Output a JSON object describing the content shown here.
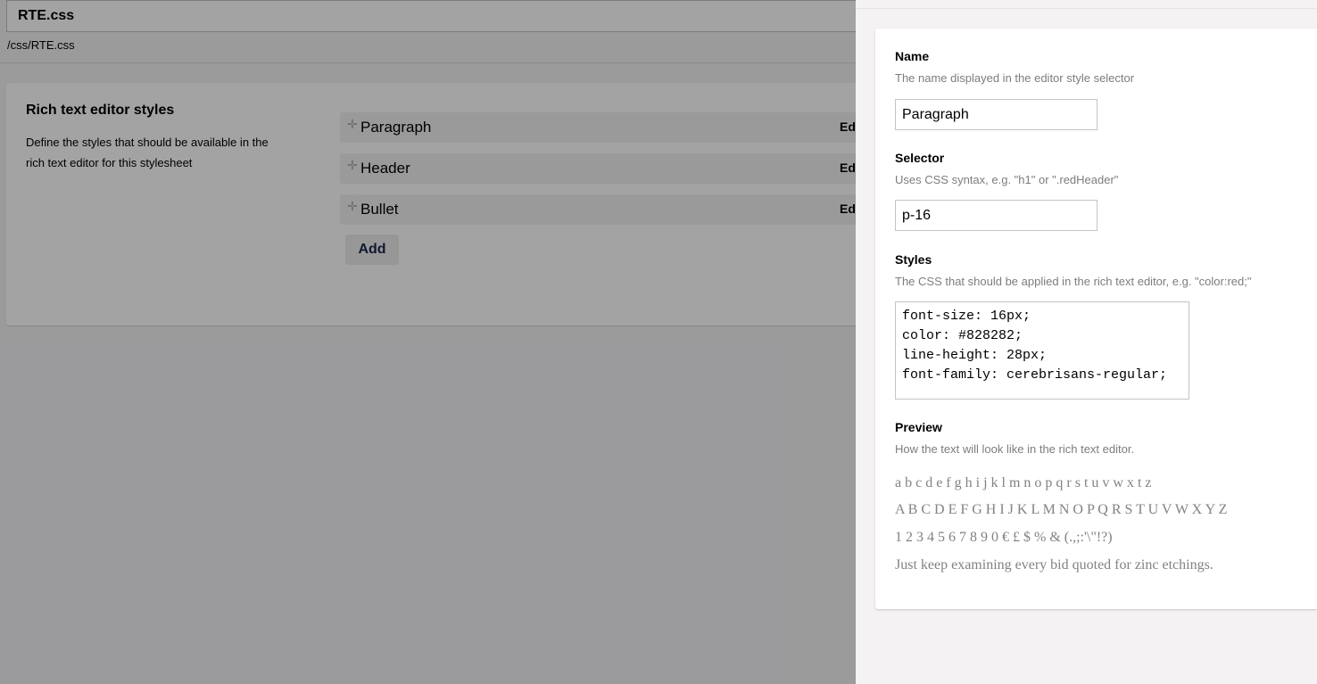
{
  "editor": {
    "name_value": "RTE.css",
    "path": "/css/RTE.css"
  },
  "rte_panel": {
    "title": "Rich text editor styles",
    "description": "Define the styles that should be available in the rich text editor for this stylesheet",
    "rules": [
      {
        "label": "Paragraph",
        "edit_label": "Ed"
      },
      {
        "label": "Header",
        "edit_label": "Ed"
      },
      {
        "label": "Bullet",
        "edit_label": "Ed"
      }
    ],
    "drag_icon": "move-handle-icon",
    "add_label": "Add"
  },
  "dialog": {
    "name": {
      "label": "Name",
      "description": "The name displayed in the editor style selector",
      "value": "Paragraph"
    },
    "selector": {
      "label": "Selector",
      "description": "Uses CSS syntax, e.g. \"h1\" or \".redHeader\"",
      "value": "p-16"
    },
    "styles": {
      "label": "Styles",
      "description": "The CSS that should be applied in the rich text editor, e.g. \"color:red;\"",
      "value": "font-size: 16px;\ncolor: #828282;\nline-height: 28px;\nfont-family: cerebrisans-regular;"
    },
    "preview": {
      "label": "Preview",
      "description": "How the text will look like in the rich text editor.",
      "lines": [
        "a b c d e f g h i j k l m n o p q r s t u v w x t z",
        "A B C D E F G H I J K L M N O P Q R S T U V W X Y Z",
        "1 2 3 4 5 6 7 8 9 0 € £ $ % & (.,;:'\\\"!?)",
        "Just keep examining every bid quoted for zinc etchings."
      ]
    }
  },
  "colors": {
    "accent_text": "#1b264f",
    "preview_text": "#828282",
    "overlay": "rgba(0,0,0,0.36)"
  }
}
